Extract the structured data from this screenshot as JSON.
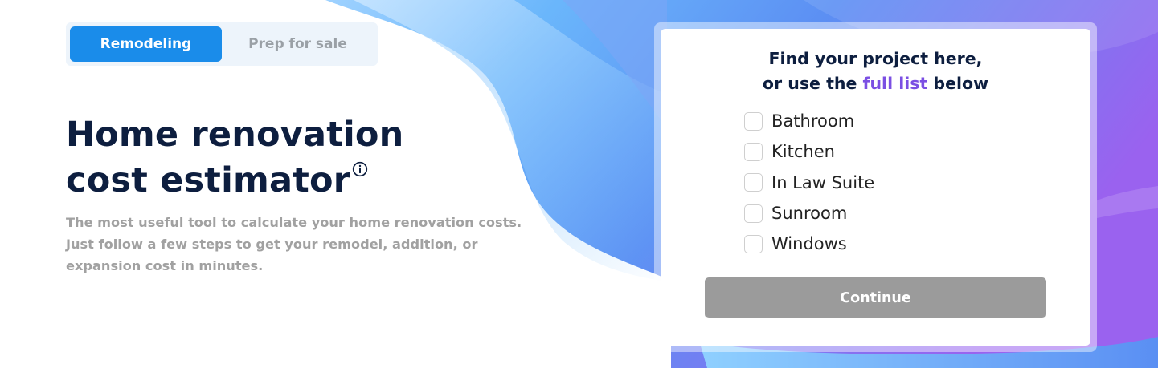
{
  "tabs": {
    "remodeling": "Remodeling",
    "prep_for_sale": "Prep for sale",
    "selected": "Remodeling"
  },
  "hero": {
    "title_line1": "Home renovation",
    "title_line2": "cost estimator",
    "subtitle": "The most useful tool to calculate your home renovation costs. Just follow a few steps to get your remodel, addition, or expansion cost in minutes."
  },
  "card": {
    "title_line1": "Find your project here,",
    "title_prefix": "or use the ",
    "title_link": "full list",
    "title_suffix": " below",
    "options": [
      {
        "label": "Bathroom",
        "checked": false
      },
      {
        "label": "Kitchen",
        "checked": false
      },
      {
        "label": "In Law Suite",
        "checked": false
      },
      {
        "label": "Sunroom",
        "checked": false
      },
      {
        "label": "Windows",
        "checked": false
      }
    ],
    "continue_label": "Continue"
  },
  "icons": {
    "info": "info-circle-icon"
  },
  "colors": {
    "accent": "#1a8cea",
    "link": "#7b4fe3",
    "heading": "#0d1e3f",
    "button_disabled": "#9b9b9b",
    "wave_blue": "#5aa6f8",
    "wave_purple": "#9a62ef"
  }
}
